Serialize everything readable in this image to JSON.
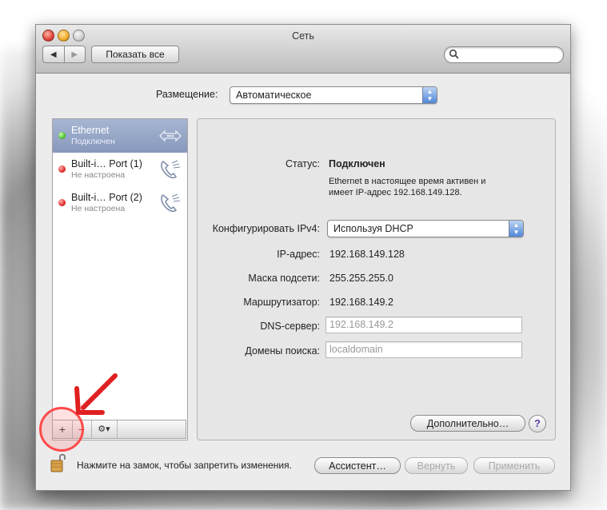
{
  "window": {
    "title": "Сеть"
  },
  "toolbar": {
    "back": "◀",
    "forward": "▶",
    "show_all": "Показать все",
    "search_placeholder": ""
  },
  "location": {
    "label": "Размещение:",
    "value": "Автоматическое"
  },
  "services": [
    {
      "name": "Ethernet",
      "status": "Подключен",
      "state": "connected",
      "icon": "ethernet-icon"
    },
    {
      "name": "Built-i… Port (1)",
      "status": "Не настроена",
      "state": "not-configured",
      "icon": "phone-modem-icon"
    },
    {
      "name": "Built-i… Port (2)",
      "status": "Не настроена",
      "state": "not-configured",
      "icon": "phone-modem-icon"
    }
  ],
  "list_buttons": {
    "add": "+",
    "remove": "−",
    "gear": "⚙▾"
  },
  "detail": {
    "status_label": "Статус:",
    "status_value": "Подключен",
    "status_desc_1": "Ethernet в настоящее время активен и",
    "status_desc_2": "имеет IP-адрес 192.168.149.128.",
    "ipv4_label": "Конфигурировать IPv4:",
    "ipv4_value": "Используя DHCP",
    "ip_label": "IP-адрес:",
    "ip_value": "192.168.149.128",
    "mask_label": "Маска подсети:",
    "mask_value": "255.255.255.0",
    "router_label": "Маршрутизатор:",
    "router_value": "192.168.149.2",
    "dns_label": "DNS-сервер:",
    "dns_value": "192.168.149.2",
    "search_label": "Домены поиска:",
    "search_value": "localdomain",
    "advanced": "Дополнительно…",
    "help": "?"
  },
  "footer": {
    "lock_message": "Нажмите на замок, чтобы запретить изменения.",
    "assistant": "Ассистент…",
    "revert": "Вернуть",
    "apply": "Применить"
  },
  "colors": {
    "selection": "#8a9bbf",
    "annotation": "#e02020"
  }
}
